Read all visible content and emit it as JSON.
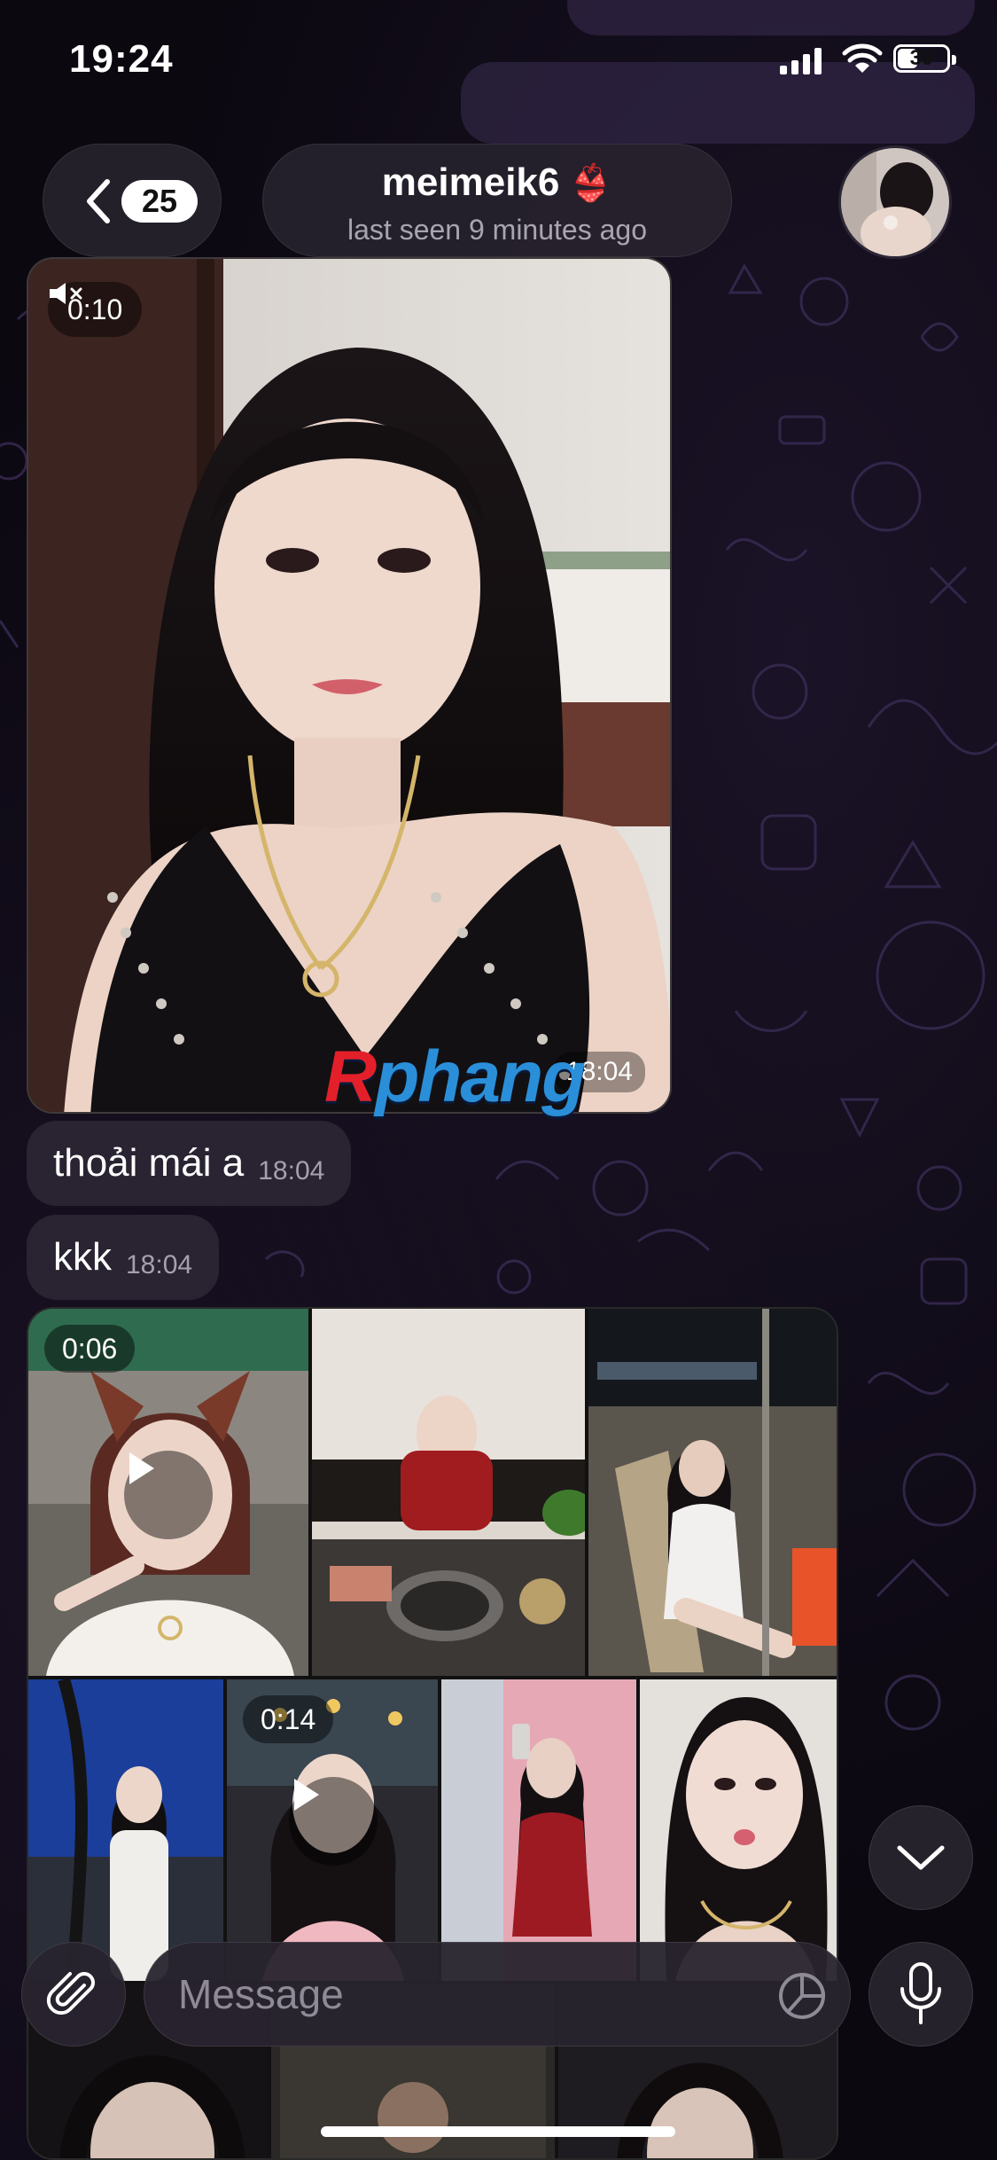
{
  "status_bar": {
    "time": "19:24",
    "battery": "39",
    "icons": [
      "signal-icon",
      "wifi-icon",
      "battery-icon"
    ]
  },
  "header": {
    "back_badge": "25",
    "chat_name": "meimeik6",
    "name_emoji": "👙",
    "last_seen": "last seen 9 minutes ago"
  },
  "messages": {
    "video": {
      "duration": "0:10",
      "time": "18:04",
      "watermark_r": "R",
      "watermark_rest": "phang"
    },
    "text_1": {
      "text": "thoải mái a",
      "time": "18:04"
    },
    "text_2": {
      "text": "kkk",
      "time": "18:04"
    }
  },
  "album": {
    "video_1_duration": "0:06",
    "video_2_duration": "0:14"
  },
  "composer": {
    "placeholder": "Message"
  },
  "colors": {
    "bubble": "#2a2331",
    "background": "#0b0810",
    "accent_watermark_red": "#e3202a",
    "accent_watermark_blue": "#2a8fd8"
  }
}
